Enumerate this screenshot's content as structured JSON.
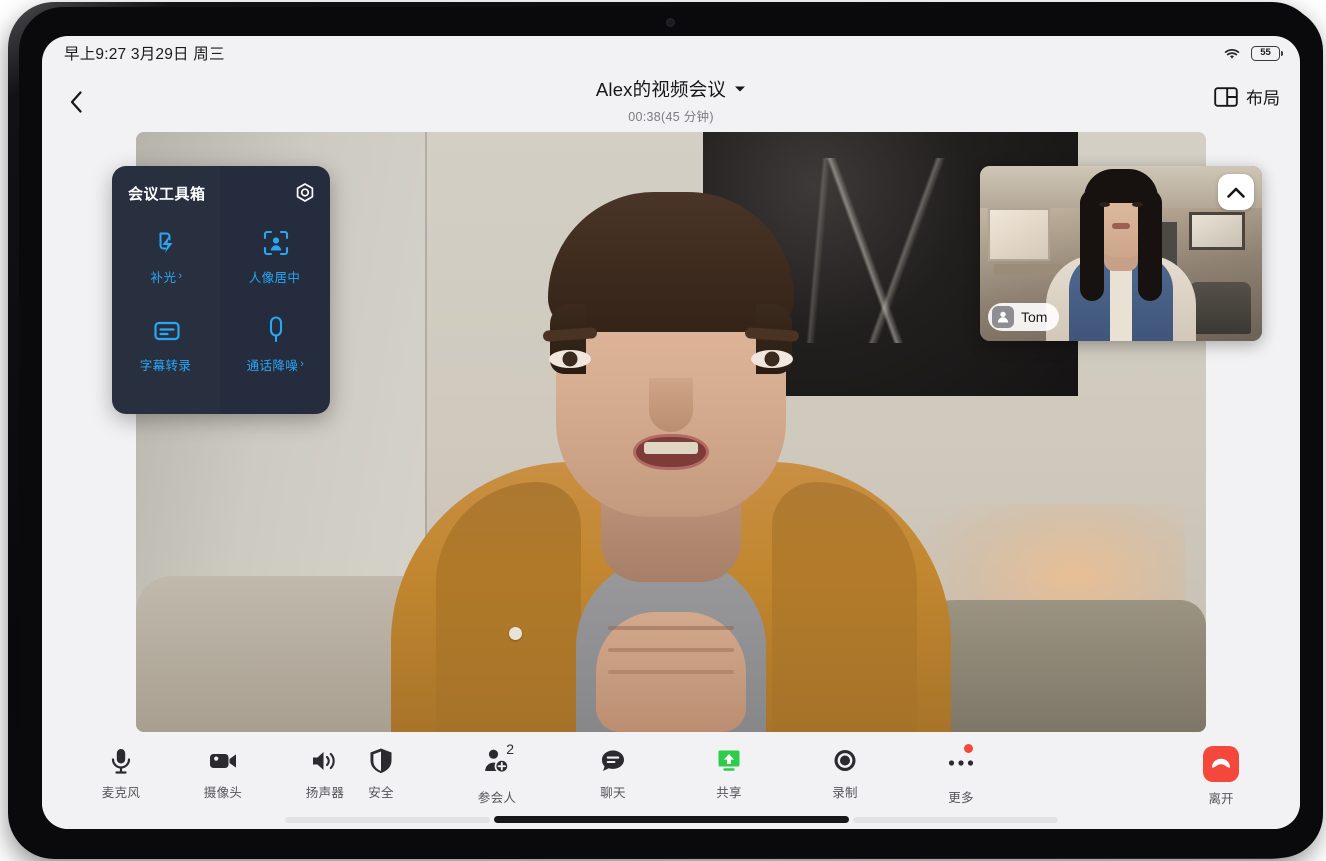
{
  "status_bar": {
    "time_date": "早上9:27 3月29日 周三",
    "wifi_icon": "wifi-icon",
    "battery_level": "55"
  },
  "header": {
    "back_icon": "chevron-left-icon",
    "meeting_title": "Alex的视频会议",
    "title_dropdown_icon": "chevron-down-icon",
    "duration": "00:38(45 分钟)",
    "layout_label": "布局",
    "layout_icon": "layout-grid-icon"
  },
  "toolbox": {
    "title": "会议工具箱",
    "settings_icon": "gear-icon",
    "items": [
      {
        "label": "补光",
        "icon": "fill-light-icon",
        "chevron": "›"
      },
      {
        "label": "人像居中",
        "icon": "portrait-center-icon",
        "chevron": ""
      },
      {
        "label": "字幕转录",
        "icon": "subtitle-transcribe-icon",
        "chevron": ""
      },
      {
        "label": "通话降噪",
        "icon": "noise-reduction-mic-icon",
        "chevron": "›"
      }
    ],
    "accent_color": "#2aa6f5",
    "panel_color": "#242c3d"
  },
  "pip": {
    "participant_name": "Tom",
    "avatar_icon": "person-icon",
    "collapse_icon": "chevron-up-icon"
  },
  "bottom_bar": {
    "left_items": [
      {
        "label": "麦克风",
        "icon": "microphone-icon"
      },
      {
        "label": "摄像头",
        "icon": "camera-icon"
      },
      {
        "label": "扬声器",
        "icon": "speaker-icon"
      }
    ],
    "center_items": [
      {
        "label": "安全",
        "icon": "shield-icon",
        "badge": ""
      },
      {
        "label": "参会人",
        "icon": "participants-icon",
        "badge": "2"
      },
      {
        "label": "聊天",
        "icon": "chat-bubble-icon",
        "badge": ""
      },
      {
        "label": "共享",
        "icon": "share-screen-icon",
        "badge": ""
      },
      {
        "label": "录制",
        "icon": "record-icon",
        "badge": ""
      },
      {
        "label": "更多",
        "icon": "more-dots-icon",
        "badge": "dot"
      }
    ],
    "leave": {
      "label": "离开",
      "icon": "hangup-icon",
      "color": "#f5483d"
    },
    "share_color": "#2ecc4a"
  }
}
